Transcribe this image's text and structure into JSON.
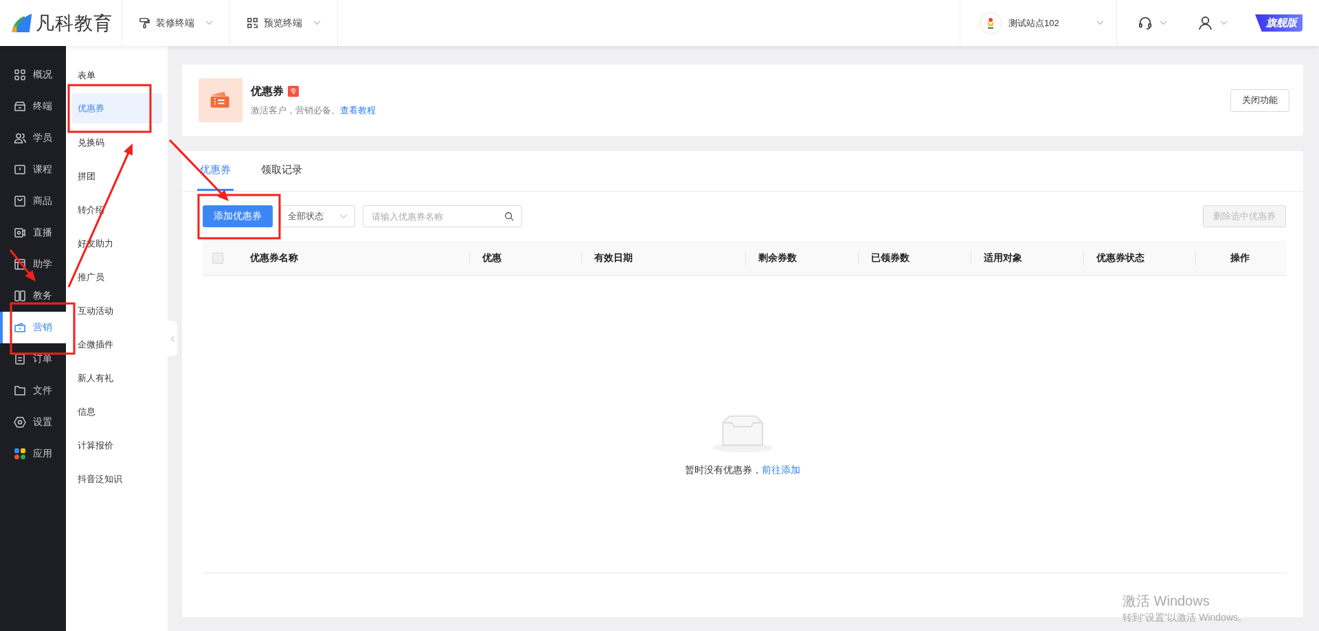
{
  "brand": "凡科教育",
  "top_nav": [
    {
      "label": "装修终端",
      "kind": "brush"
    },
    {
      "label": "预览终端",
      "kind": "qr"
    }
  ],
  "site": {
    "name": "测试站点102"
  },
  "edition_badge": "旗舰版",
  "main_nav": [
    {
      "label": "概况",
      "selected": false
    },
    {
      "label": "终端",
      "selected": false
    },
    {
      "label": "学员",
      "selected": false
    },
    {
      "label": "课程",
      "selected": false
    },
    {
      "label": "商品",
      "selected": false
    },
    {
      "label": "直播",
      "selected": false
    },
    {
      "label": "助学",
      "selected": false
    },
    {
      "label": "教务",
      "selected": false
    },
    {
      "label": "营销",
      "selected": true
    },
    {
      "label": "订单",
      "selected": false
    },
    {
      "label": "文件",
      "selected": false
    },
    {
      "label": "设置",
      "selected": false
    },
    {
      "label": "应用",
      "selected": false
    }
  ],
  "sub_nav": [
    {
      "label": "表单",
      "selected": false
    },
    {
      "label": "优惠券",
      "selected": true
    },
    {
      "label": "兑换码",
      "selected": false
    },
    {
      "label": "拼团",
      "selected": false
    },
    {
      "label": "转介绍",
      "selected": false
    },
    {
      "label": "好友助力",
      "selected": false
    },
    {
      "label": "推广员",
      "selected": false
    },
    {
      "label": "互动活动",
      "selected": false
    },
    {
      "label": "企微插件",
      "selected": false
    },
    {
      "label": "新人有礼",
      "selected": false
    },
    {
      "label": "信息",
      "selected": false
    },
    {
      "label": "计算报价",
      "selected": false
    },
    {
      "label": "抖音泛知识",
      "selected": false
    }
  ],
  "feature": {
    "title": "优惠券",
    "badge": "专",
    "description": "激活客户，营销必备。",
    "link": "查看教程",
    "button": "关闭功能"
  },
  "tabs": [
    {
      "label": "优惠券",
      "selected": true
    },
    {
      "label": "领取记录",
      "selected": false
    }
  ],
  "toolbar": {
    "add_button": "添加优惠券",
    "status_select": "全部状态",
    "search": {
      "placeholder": "请输入优惠券名称"
    },
    "delete_button": {
      "label": "删除选中优惠券",
      "disabled": true
    }
  },
  "table": {
    "select_all": {
      "checked": false
    },
    "columns": [
      "优惠券名称",
      "优惠",
      "有效日期",
      "剩余券数",
      "已领券数",
      "适用对象",
      "优惠券状态",
      "操作"
    ]
  },
  "empty_state": {
    "message": "暂时没有优惠券，",
    "link": "前往添加"
  },
  "os_watermark": {
    "title": "激活 Windows",
    "hint": "转到“设置”以激活 Windows。"
  }
}
